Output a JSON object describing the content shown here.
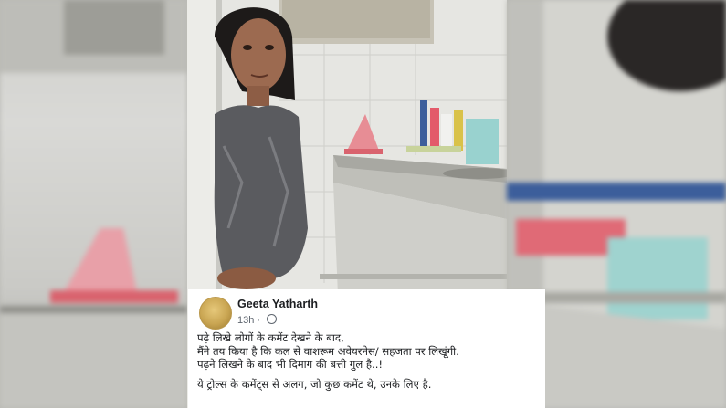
{
  "post": {
    "author": "Geeta Yatharth",
    "time": "13h",
    "dot": "·",
    "lines": [
      "पढ़े लिखे लोगों के कमेंट देखने के बाद,",
      "मैंने तय किया है कि कल से वाशरूम अवेयरनेस/ सहजता पर लिखूंगी.",
      "पढ़ने लिखने के बाद भी दिमाग की बत्ती गुल है..!",
      "ये ट्रोल्स के कमेंट्स से अलग, जो कुछ कमेंट थे, उनके लिए है."
    ]
  },
  "icons": {
    "privacy": "globe-icon",
    "avatar": "profile-photo"
  },
  "colors": {
    "card_bg": "#ffffff",
    "author_text": "#1c1e21",
    "meta_text": "#606770"
  }
}
